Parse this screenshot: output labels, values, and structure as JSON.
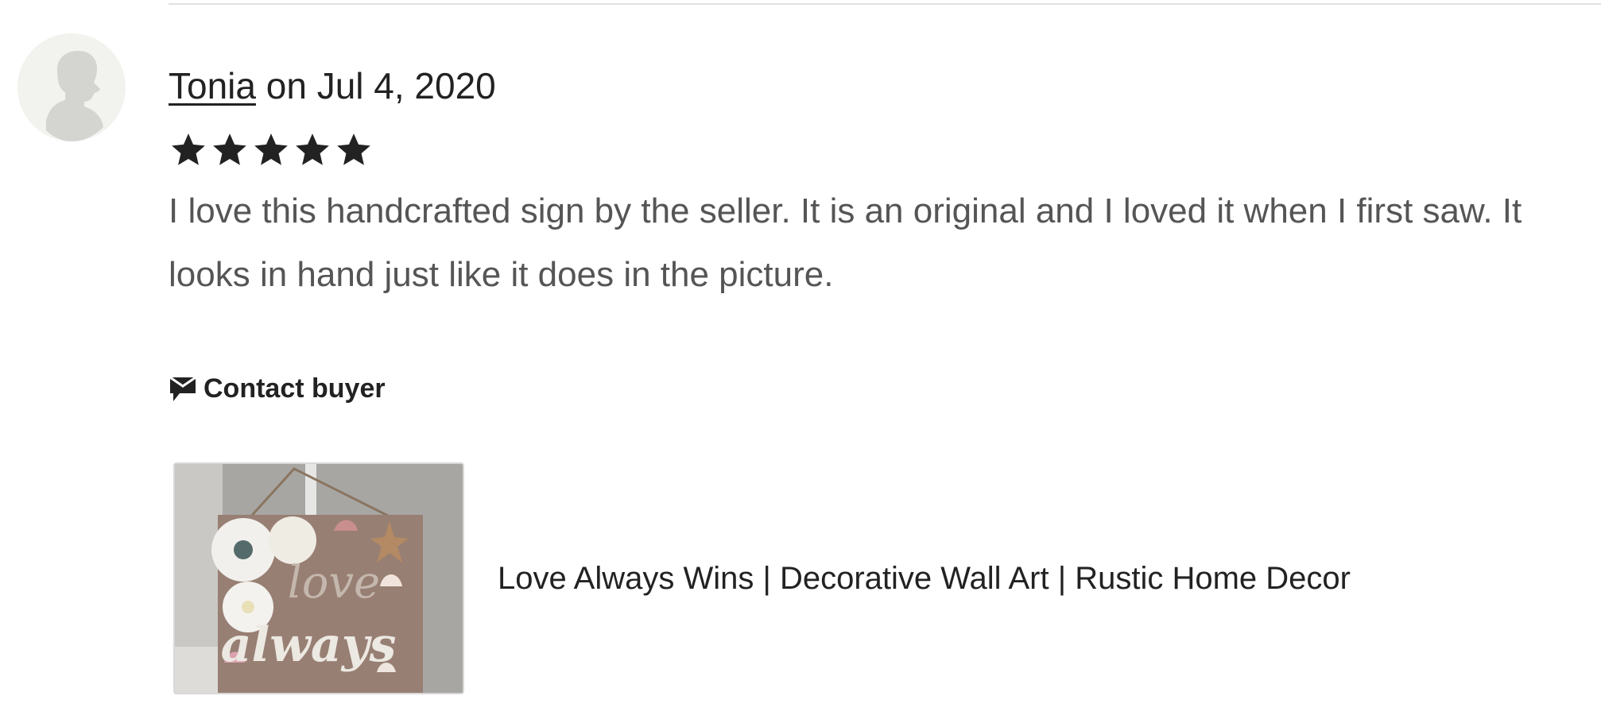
{
  "review": {
    "reviewer_name": "Tonia",
    "date_text": " on Jul 4, 2020",
    "rating": 5,
    "rating_max": 5,
    "text_line1": "I love this handcrafted sign by the seller. It is an original and I loved it when I first saw. It",
    "text_line2": "looks in hand just like it does in the picture."
  },
  "actions": {
    "contact_buyer_label": "Contact buyer",
    "contact_buyer_icon": "message-icon"
  },
  "listing": {
    "title": "Love Always Wins | Decorative Wall Art | Rustic Home Decor",
    "thumbnail_text_line1": "love",
    "thumbnail_text_line2": "always"
  },
  "colors": {
    "star": "#222222",
    "text_primary": "#222222",
    "text_secondary": "#555555",
    "divider": "#e1e1e1"
  }
}
